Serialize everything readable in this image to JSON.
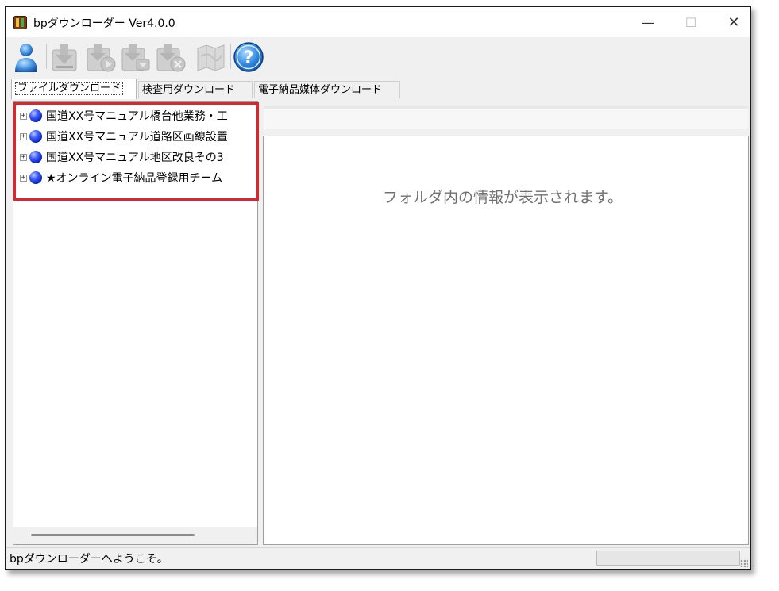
{
  "window": {
    "title": "bpダウンローダー Ver4.0.0",
    "minimize_glyph": "—",
    "maximize_glyph": "☐",
    "close_glyph": "✕"
  },
  "toolbar": {
    "buttons": [
      {
        "icon": "user-icon",
        "enabled": true
      },
      {
        "icon": "download-icon",
        "enabled": false
      },
      {
        "icon": "play-download-icon",
        "enabled": false
      },
      {
        "icon": "download-folder-icon",
        "enabled": false
      },
      {
        "icon": "delete-download-icon",
        "enabled": false
      },
      {
        "icon": "map-icon",
        "enabled": false
      },
      {
        "icon": "help-icon",
        "enabled": true
      }
    ]
  },
  "tabs": [
    {
      "label": "ファイルダウンロード",
      "active": true
    },
    {
      "label": "検査用ダウンロード",
      "active": false
    },
    {
      "label": "電子納品媒体ダウンロード",
      "active": false
    }
  ],
  "tree": {
    "nodes": [
      {
        "label": "国道XX号マニュアル橋台他業務・工"
      },
      {
        "label": "国道XX号マニュアル道路区画線設置"
      },
      {
        "label": "国道XX号マニュアル地区改良その3"
      },
      {
        "label": "★オンライン電子納品登録用チーム"
      }
    ],
    "expander_glyph": "+",
    "highlight_color": "#e0242b"
  },
  "content": {
    "placeholder": "フォルダ内の情報が表示されます。"
  },
  "status": {
    "text": "bpダウンローダーへようこそ。"
  }
}
